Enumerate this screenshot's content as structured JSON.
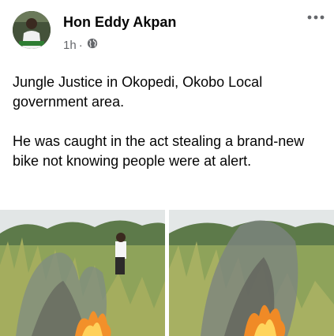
{
  "post": {
    "author": "Hon Eddy Akpan",
    "time": "1h",
    "separator": "·",
    "privacy_icon": "globe-icon",
    "more_icon": "more-horizontal-icon",
    "paragraphs": [
      "Jungle Justice in Okopedi, Okobo Local government area.",
      "He was caught in the act stealing a brand-new bike not knowing people were at alert."
    ]
  },
  "colors": {
    "text_primary": "#050505",
    "text_secondary": "#65676b"
  }
}
